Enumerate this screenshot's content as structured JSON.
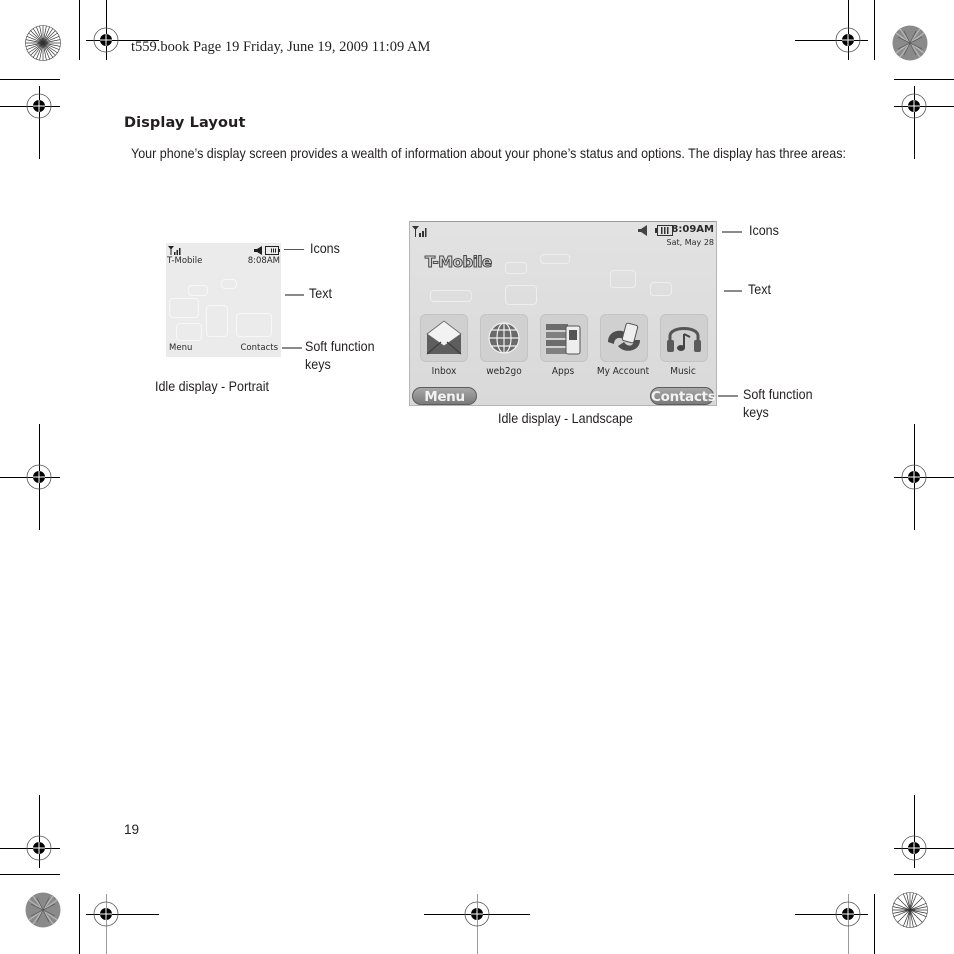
{
  "print_header": {
    "text": "t559.book  Page 19  Friday, June 19, 2009  11:09 AM"
  },
  "section": {
    "title": "Display Layout",
    "body": "Your phone’s display screen provides a wealth of information about your phone’s status and options. The display has three areas:"
  },
  "portrait_figure": {
    "caption": "Idle display - Portrait",
    "screen": {
      "status_icons": [
        "signal-strength-icon",
        "speaker-icon",
        "battery-icon"
      ],
      "carrier": "T-Mobile",
      "time": "8:08AM",
      "left_softkey": "Menu",
      "right_softkey": "Contacts"
    },
    "callouts": [
      "Icons",
      "Text",
      "Soft function keys"
    ]
  },
  "landscape_figure": {
    "caption": "Idle display - Landscape",
    "screen": {
      "status_icons": [
        "signal-strength-icon",
        "speaker-icon",
        "battery-icon"
      ],
      "time": "8:09AM",
      "date": "Sat, May 28",
      "carrier": "T-Mobile",
      "shortcuts": [
        {
          "label": "Inbox",
          "icon": "envelope-icon"
        },
        {
          "label": "web2go",
          "icon": "globe-icon"
        },
        {
          "label": "Apps",
          "icon": "apps-icon"
        },
        {
          "label": "My Account",
          "icon": "account-icon"
        },
        {
          "label": "Music",
          "icon": "headphones-icon"
        }
      ],
      "left_softkey": "Menu",
      "right_softkey": "Contacts"
    },
    "callouts": [
      "Icons",
      "Text",
      "Soft function keys"
    ]
  },
  "footer": {
    "page_number": "19"
  }
}
